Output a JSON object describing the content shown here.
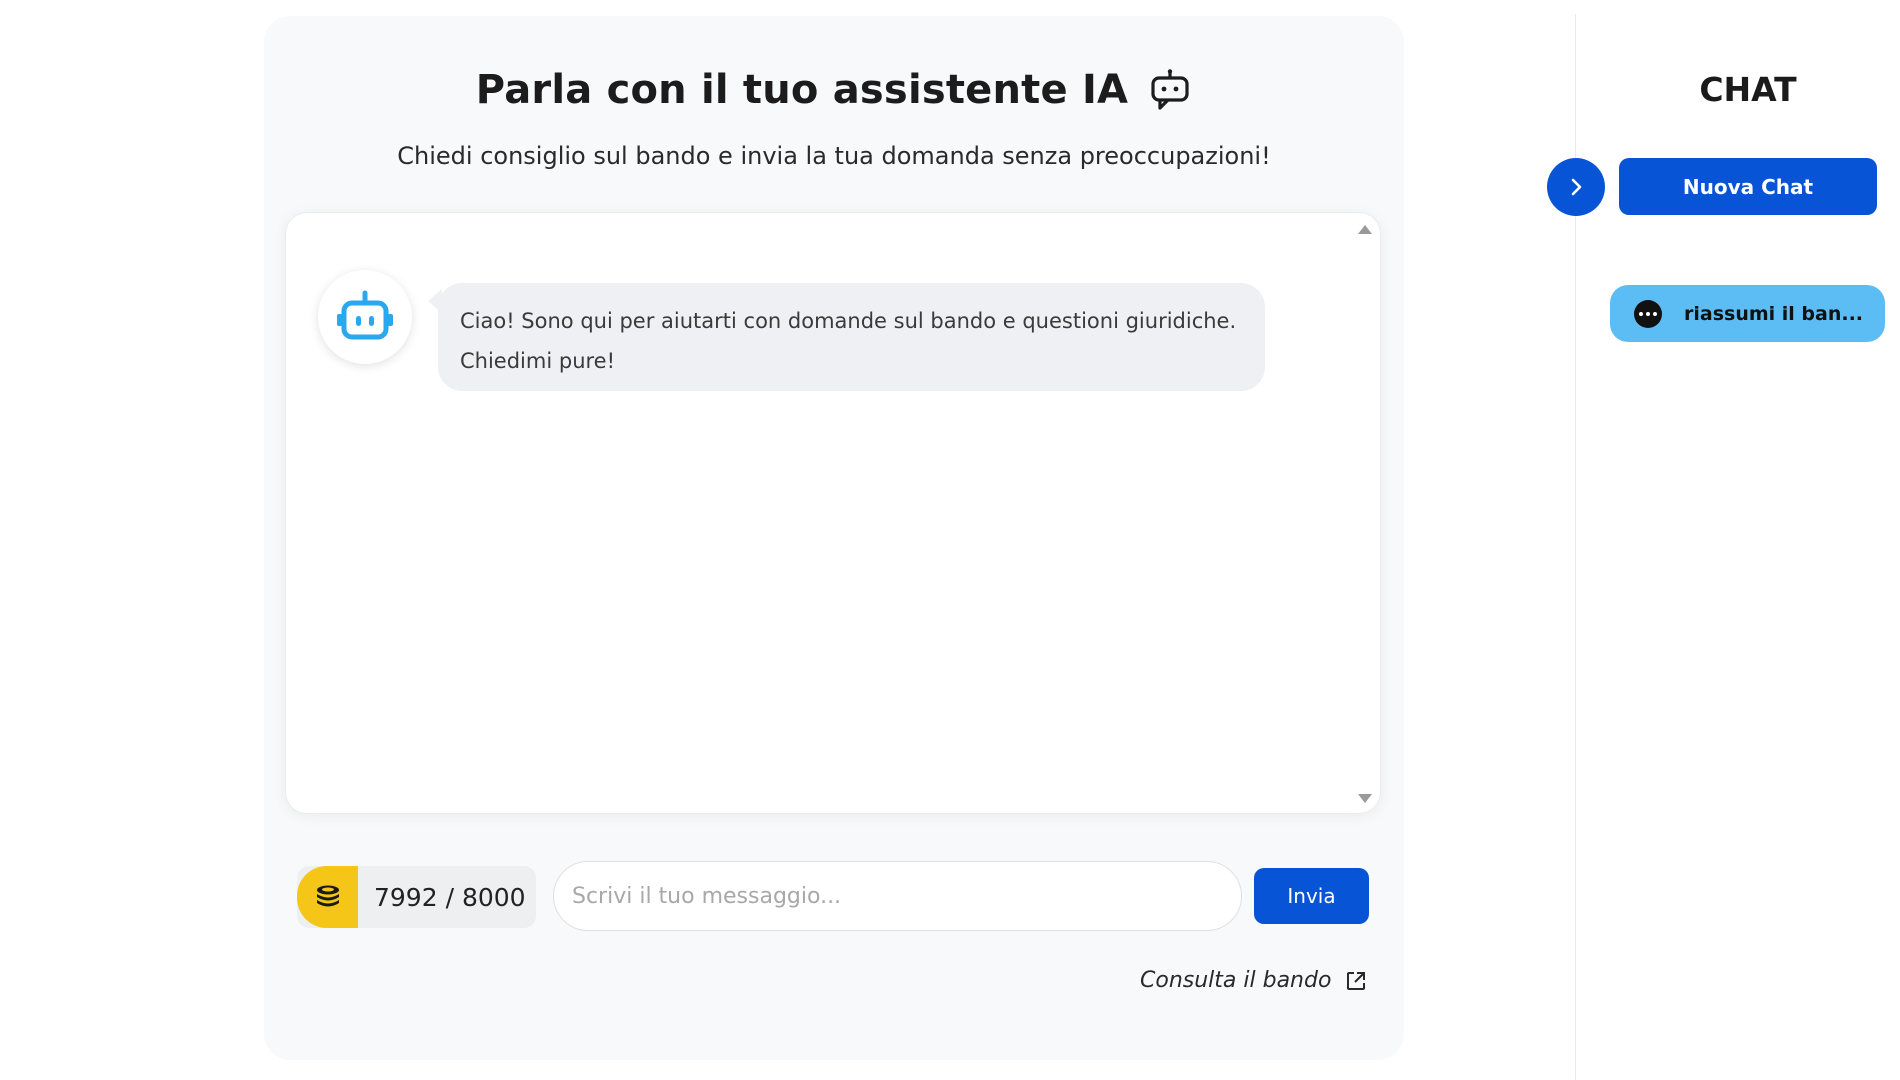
{
  "header": {
    "title": "Parla con il tuo assistente IA",
    "subtitle": "Chiedi consiglio sul bando e invia la tua domanda senza preoccupazioni!",
    "title_icon": "chat-bot-icon"
  },
  "chat": {
    "messages": [
      {
        "sender": "bot",
        "avatar_icon": "robot-icon",
        "line1": "Ciao! Sono qui per aiutarti con domande sul bando e questioni giuridiche.",
        "line2": "Chiedimi pure!"
      }
    ]
  },
  "footer": {
    "tokens": "7992 / 8000",
    "token_icon": "coins-icon",
    "input_placeholder": "Scrivi il tuo messaggio...",
    "input_value": "",
    "send_label": "Invia",
    "consult_label": "Consulta il bando",
    "consult_icon": "external-link-icon"
  },
  "sidebar": {
    "title": "CHAT",
    "toggle_icon": "chevron-right-icon",
    "new_chat_label": "Nuova Chat",
    "items": [
      {
        "label": "riassumi il ban...",
        "icon": "more-dots-icon"
      }
    ]
  },
  "colors": {
    "primary": "#0755d6",
    "accent_light": "#5bbdf4",
    "coin": "#f5c518",
    "robot": "#29a8f0",
    "bubble": "#eef0f3"
  }
}
